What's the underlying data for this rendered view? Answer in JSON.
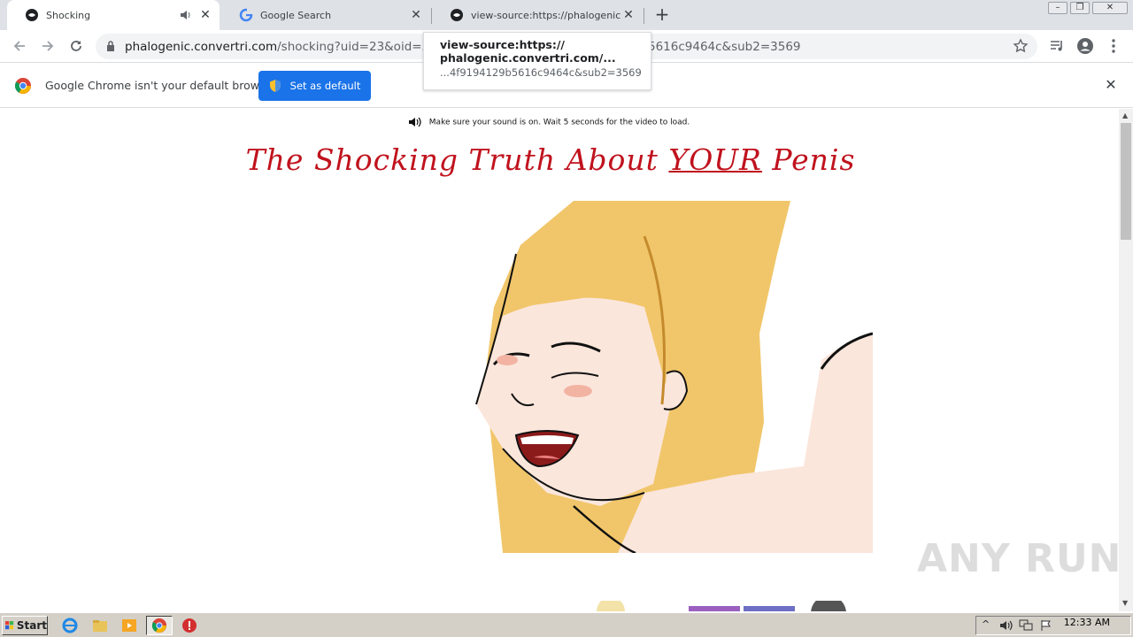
{
  "browser": {
    "tabs": [
      {
        "title": "Shocking",
        "icon": "globe-icon",
        "active": true,
        "audio": true
      },
      {
        "title": "Google Search",
        "icon": "google-icon",
        "active": false
      },
      {
        "title": "view-source:https://phalogenic.conv",
        "icon": "globe-icon",
        "active": false
      }
    ],
    "new_tab_label": "+",
    "url_host": "phalogenic.convertri.com",
    "url_path": "/shocking?uid=23&oid=3&affi",
    "url_tail": "5616c9464c&sub2=3569",
    "tooltip": {
      "line1": "view-source:https://",
      "line2": "phalogenic.convertri.com/...",
      "line3": "...4f9194129b5616c9464c&sub2=3569"
    },
    "window_controls": [
      "–",
      "❐",
      "✕"
    ]
  },
  "infobar": {
    "message": "Google Chrome isn't your default browser",
    "button_label": "Set as default",
    "close_label": "✕"
  },
  "page": {
    "sound_note": "Make sure your sound is on. Wait 5 seconds for the video to load.",
    "headline_pre": "The Shocking Truth About ",
    "headline_em": "YOUR",
    "headline_post": " Penis"
  },
  "watermark": "ANY RUN",
  "taskbar": {
    "start_label": "Start",
    "clock": "12:33 AM"
  },
  "colors": {
    "headline": "#c0121d",
    "accent_button": "#1a73e8",
    "tabstrip": "#dee1e6",
    "taskbar": "#d4d0c8"
  }
}
